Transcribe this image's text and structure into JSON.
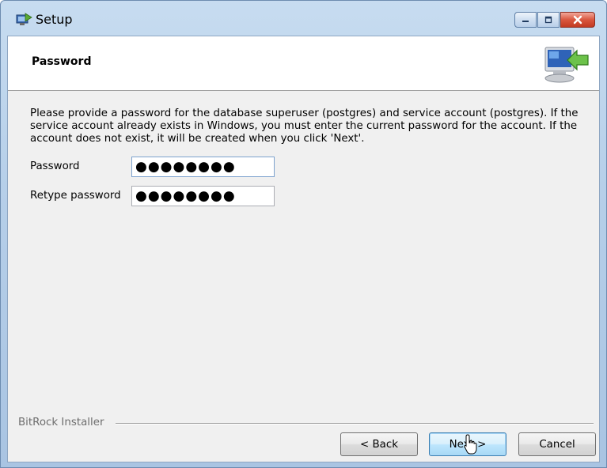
{
  "window": {
    "title": "Setup"
  },
  "header": {
    "title": "Password",
    "graphic_icon": "computer-install-icon"
  },
  "content": {
    "description": "Please provide a password for the database superuser (postgres) and service account (postgres). If the service account already exists in Windows, you must enter the current password for the account. If the account does not exist, it will be created when you click 'Next'.",
    "password_label": "Password",
    "password_value": "●●●●●●●●",
    "retype_label": "Retype password",
    "retype_value": "●●●●●●●●"
  },
  "footer": {
    "brand": "BitRock Installer",
    "back_label": "< Back",
    "next_label": "Next >",
    "cancel_label": "Cancel"
  },
  "colors": {
    "titlebar": "#b6cfe9",
    "client_bg": "#f0f0f0",
    "close_button": "#c23a22",
    "default_button": "#bee6fd"
  }
}
